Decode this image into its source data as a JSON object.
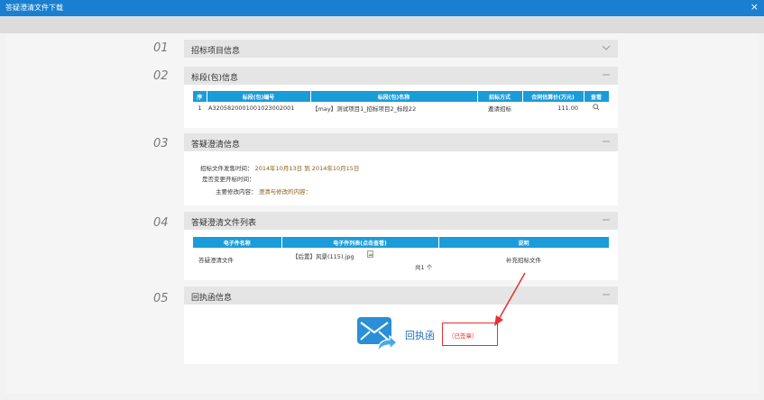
{
  "window": {
    "title": "答疑澄清文件下载",
    "close": "×"
  },
  "sections": [
    {
      "num": "01",
      "title": "招标项目信息"
    },
    {
      "num": "02",
      "title": "标段(包)信息"
    },
    {
      "num": "03",
      "title": "答疑澄清信息"
    },
    {
      "num": "04",
      "title": "答疑澄清文件列表"
    },
    {
      "num": "05",
      "title": "回执函信息"
    }
  ],
  "bid_table": {
    "headers": [
      "序",
      "标段(包)编号",
      "标段(包)名称",
      "招标方式",
      "合同估算价(万元)",
      "查看"
    ],
    "rows": [
      {
        "seq": "1",
        "code": "A3205820001001023002001",
        "name": "【may】测试项目1_招标项目2_标段22",
        "method": "邀请招标",
        "price": "111.00"
      }
    ]
  },
  "clarify": {
    "time_label": "招标文件发售时间：",
    "time_value": "2014年10月13日 到 2014年10月15日",
    "change_label": "是否变更开标时间：",
    "content_label": "主要修改内容：",
    "content_value": "澄清与修改的内容："
  },
  "file_table": {
    "headers": [
      "电子件名称",
      "电子件列表(点击查看)",
      "说明"
    ],
    "rows": [
      {
        "name": "答疑澄清文件",
        "file": "【后置】风景(115).jpg",
        "count": "共1 个",
        "desc": "补充招标文件"
      }
    ]
  },
  "receipt": {
    "label": "回执函",
    "status": "（已签章）"
  },
  "colors": {
    "titlebar": "#1a7fd0",
    "table_header": "#1a9cd8",
    "link": "#1a6fc0",
    "annotation": "#e53030"
  }
}
